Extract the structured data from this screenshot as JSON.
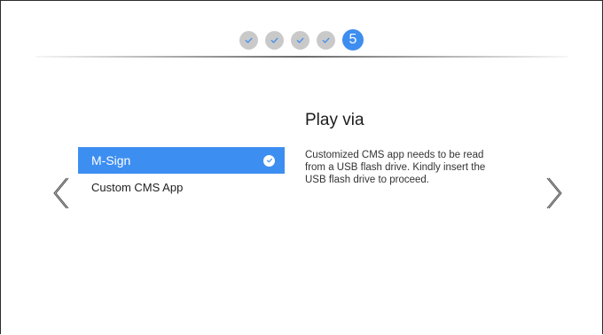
{
  "stepper": {
    "completed_steps": [
      {
        "icon": "check-icon"
      },
      {
        "icon": "check-icon"
      },
      {
        "icon": "check-icon"
      },
      {
        "icon": "check-icon"
      }
    ],
    "current_step": "5",
    "completed_color": "#c9c9c9",
    "check_color": "#3e8ef0",
    "current_color": "#3e8ef0"
  },
  "options": {
    "items": [
      {
        "label": "M-Sign",
        "selected": true,
        "icon": "check-circle-icon"
      },
      {
        "label": "Custom CMS App",
        "selected": false
      }
    ],
    "selected_color": "#3d8ef1"
  },
  "panel": {
    "title": "Play via",
    "description": "Customized CMS app needs to be read from a USB flash drive. Kindly insert the USB flash drive to proceed."
  },
  "navigation": {
    "prev_icon": "chevron-left-icon",
    "next_icon": "chevron-right-icon"
  }
}
